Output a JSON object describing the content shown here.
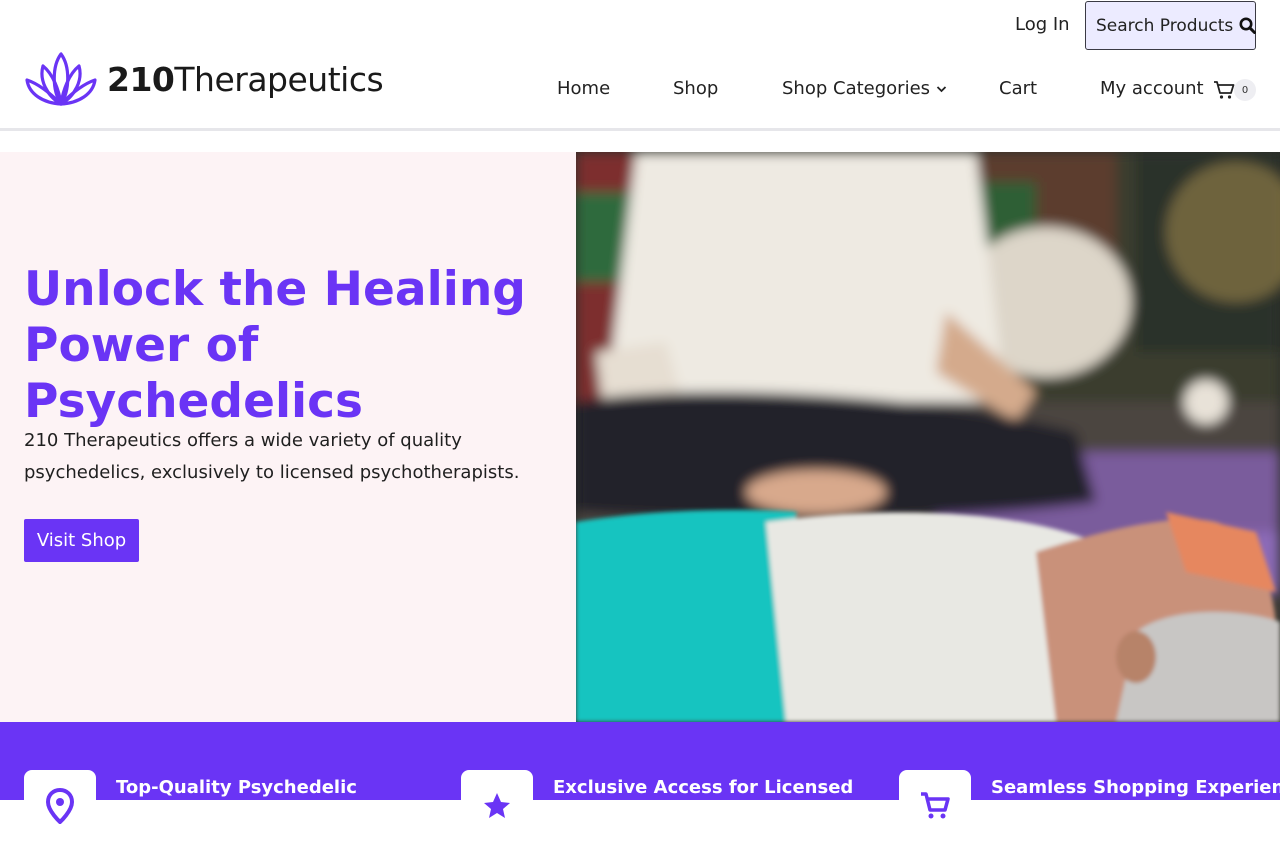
{
  "brand": {
    "number": "210",
    "name": "Therapeutics"
  },
  "topbar": {
    "login": "Log In",
    "search_label": "Search Products"
  },
  "nav": {
    "home": "Home",
    "shop": "Shop",
    "categories": "Shop Categories",
    "cart": "Cart",
    "account": "My account",
    "cart_count": "0"
  },
  "hero": {
    "title": "Unlock the Healing Power of Psychedelics",
    "text": "210 Therapeutics offers a wide variety of quality psychedelics, exclusively to licensed psychotherapists.",
    "button": "Visit Shop"
  },
  "features": [
    {
      "title": "Top-Quality Psychedelic",
      "icon": "location-pin-icon"
    },
    {
      "title": "Exclusive Access for Licensed",
      "icon": "star-icon"
    },
    {
      "title": "Seamless Shopping Experience",
      "icon": "shopping-cart-icon"
    }
  ],
  "colors": {
    "accent": "#6a34f5",
    "hero_bg": "#fdf3f5",
    "search_bg": "#ecebff"
  }
}
